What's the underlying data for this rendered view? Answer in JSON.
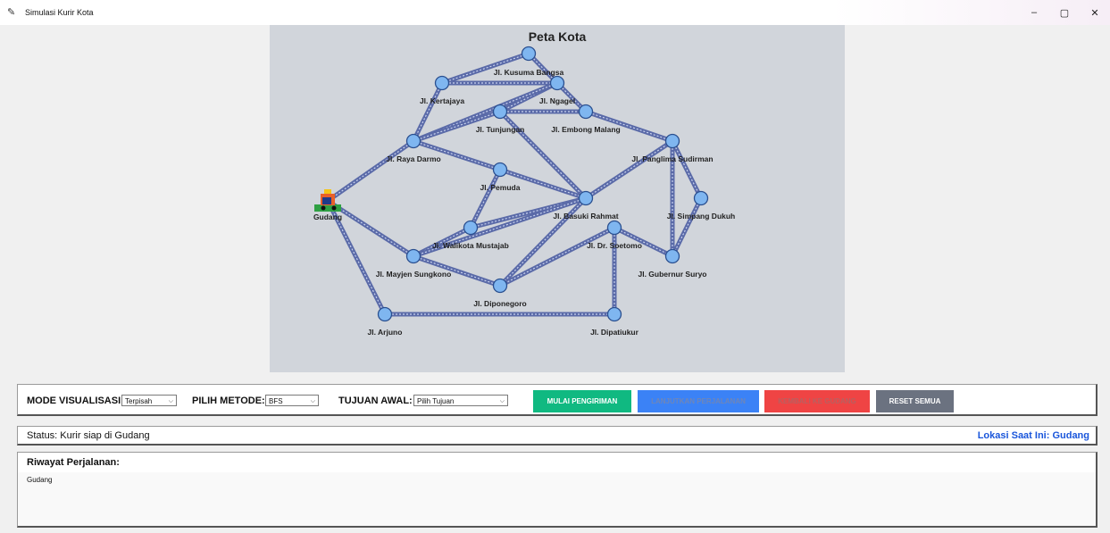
{
  "window": {
    "title": "Simulasi Kurir Kota",
    "controls": {
      "minimize": "–",
      "restore": "▢",
      "close": "✕"
    }
  },
  "map": {
    "title": "Peta Kota",
    "depot_label": "Gudang",
    "nodes": [
      {
        "id": "gudang",
        "label": "Gudang"
      },
      {
        "id": "kusuma",
        "label": "Jl. Kusuma Bangsa"
      },
      {
        "id": "kertajaya",
        "label": "Jl. Kertajaya"
      },
      {
        "id": "ngagel",
        "label": "Jl. Ngagel"
      },
      {
        "id": "tunjungan",
        "label": "Jl. Tunjungan"
      },
      {
        "id": "embong",
        "label": "Jl. Embong Malang"
      },
      {
        "id": "raya",
        "label": "Jl. Raya Darmo"
      },
      {
        "id": "panglima",
        "label": "Jl. Panglima Sudirman"
      },
      {
        "id": "pemuda",
        "label": "Jl. Pemuda"
      },
      {
        "id": "simpang",
        "label": "Jl. Simpang Dukuh"
      },
      {
        "id": "basuki",
        "label": "Jl. Basuki Rahmat"
      },
      {
        "id": "walikota",
        "label": "Jl. Walikota Mustajab"
      },
      {
        "id": "soetomo",
        "label": "Jl. Dr. Soetomo"
      },
      {
        "id": "mayjen",
        "label": "Jl. Mayjen Sungkono"
      },
      {
        "id": "gubernur",
        "label": "Jl. Gubernur Suryo"
      },
      {
        "id": "diponegoro",
        "label": "Jl. Diponegoro"
      },
      {
        "id": "arjuno",
        "label": "Jl. Arjuno"
      },
      {
        "id": "dipatiukur",
        "label": "Jl. Dipatiukur"
      }
    ],
    "edges": [
      [
        "kusuma",
        "kertajaya"
      ],
      [
        "kusuma",
        "ngagel"
      ],
      [
        "kertajaya",
        "ngagel"
      ],
      [
        "kertajaya",
        "raya"
      ],
      [
        "ngagel",
        "tunjungan"
      ],
      [
        "ngagel",
        "embong"
      ],
      [
        "ngagel",
        "raya"
      ],
      [
        "tunjungan",
        "embong"
      ],
      [
        "tunjungan",
        "basuki"
      ],
      [
        "embong",
        "panglima"
      ],
      [
        "raya",
        "pemuda"
      ],
      [
        "raya",
        "gudang"
      ],
      [
        "raya",
        "tunjungan"
      ],
      [
        "pemuda",
        "basuki"
      ],
      [
        "pemuda",
        "walikota"
      ],
      [
        "gudang",
        "mayjen"
      ],
      [
        "gudang",
        "arjuno"
      ],
      [
        "walikota",
        "mayjen"
      ],
      [
        "walikota",
        "basuki"
      ],
      [
        "basuki",
        "panglima"
      ],
      [
        "basuki",
        "diponegoro"
      ],
      [
        "basuki",
        "mayjen"
      ],
      [
        "panglima",
        "simpang"
      ],
      [
        "panglima",
        "gubernur"
      ],
      [
        "simpang",
        "gubernur"
      ],
      [
        "soetomo",
        "gubernur"
      ],
      [
        "soetomo",
        "diponegoro"
      ],
      [
        "soetomo",
        "dipatiukur"
      ],
      [
        "mayjen",
        "diponegoro"
      ],
      [
        "arjuno",
        "dipatiukur"
      ]
    ],
    "colors": {
      "background": "#d1d5db",
      "edge": "#5a6aa8",
      "node": "#7fb6f0",
      "node_stroke": "#2a4f8f"
    }
  },
  "controls": {
    "mode_label": "MODE VISUALISASI:",
    "mode_value": "Terpisah",
    "method_label": "PILIH METODE:",
    "method_value": "BFS",
    "target_label": "TUJUAN AWAL:",
    "target_value": "Pilih Tujuan",
    "buttons": {
      "start": {
        "label": "MULAI PENGIRIMAN",
        "color": "#10b981"
      },
      "continue": {
        "label": "LANJUTKAN PERJALANAN",
        "color": "#3b82f6"
      },
      "back": {
        "label": "KEMBALI KE GUDANG",
        "color": "#ef4444"
      },
      "reset": {
        "label": "RESET SEMUA",
        "color": "#6b7280"
      }
    }
  },
  "status": {
    "text": "Status: Kurir siap di Gudang",
    "location": "Lokasi Saat Ini: Gudang"
  },
  "history": {
    "heading": "Riwayat Perjalanan:",
    "entries": [
      "Gudang"
    ]
  }
}
